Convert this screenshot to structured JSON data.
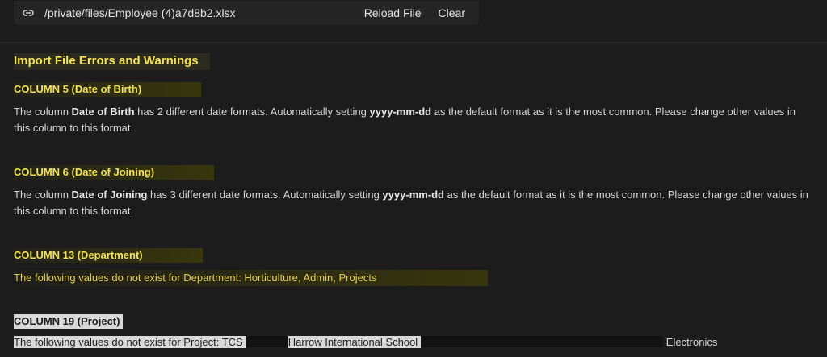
{
  "toolbar": {
    "file_path": "/private/files/Employee (4)a7d8b2.xlsx",
    "reload_label": "Reload File",
    "clear_label": "Clear",
    "link_icon": "link-icon"
  },
  "title": "Import File Errors and Warnings",
  "sections": [
    {
      "heading": "COLUMN 5 (Date of Birth)",
      "pre": "The column ",
      "field": "Date of Birth",
      "mid": " has 2 different date formats. Automatically setting ",
      "format": "yyyy-mm-dd",
      "post": " as the default format as it is the most common. Please change other values in this column to this format."
    },
    {
      "heading": "COLUMN 6 (Date of Joining)",
      "pre": "The column ",
      "field": "Date of Joining",
      "mid": " has 3 different date formats. Automatically setting ",
      "format": "yyyy-mm-dd",
      "post": " as the default format as it is the most common. Please change other values in this column to this format."
    },
    {
      "heading": "COLUMN 13 (Department)",
      "message": "The following values do not exist for Department: Horticulture, Admin, Projects"
    },
    {
      "heading": "COLUMN 19 (Project)",
      "message_start": "The following values do not exist for Project: TCS",
      "message_mid": "Harrow International School",
      "message_tail": "Electronics"
    }
  ]
}
